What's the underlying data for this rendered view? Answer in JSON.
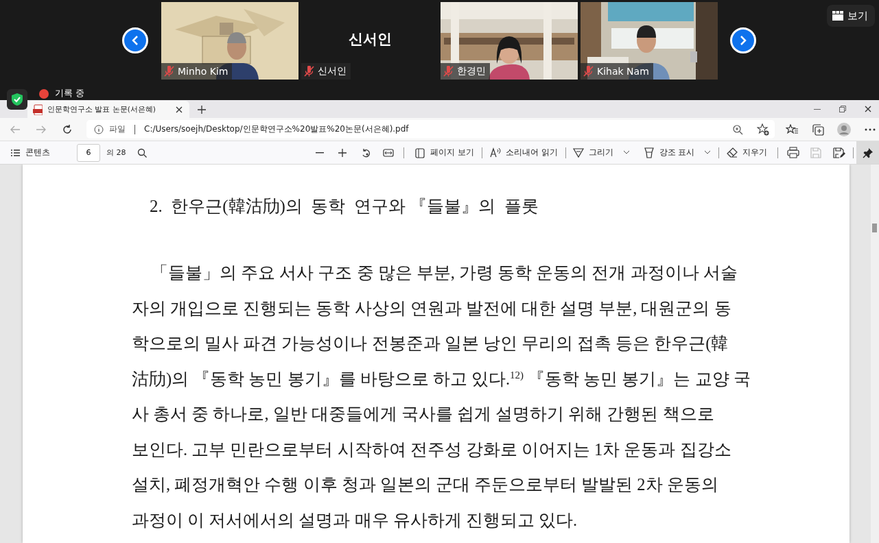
{
  "meeting": {
    "participants": [
      {
        "kind": "video",
        "name": "Minho Kim",
        "muted": true
      },
      {
        "kind": "name",
        "name": "신서인",
        "label": "신서인",
        "muted": true
      },
      {
        "kind": "video",
        "name": "한경민",
        "muted": true
      },
      {
        "kind": "video",
        "name": "Kihak Nam",
        "muted": true
      }
    ],
    "view_button": "보기",
    "recording": "기록 중"
  },
  "browser": {
    "tabs": [
      {
        "title": "인문학연구소 발표 논문(서은혜)",
        "selected": true
      }
    ],
    "address": {
      "scheme": "파일",
      "url": "C:/Users/soejh/Desktop/인문학연구소%20발표%20논문(서은혜).pdf"
    },
    "pdf_toolbar": {
      "contents": "콘텐츠",
      "page": "6",
      "page_count": "의 28",
      "tools": [
        {
          "kind": "pageview",
          "label": "페이지 보기",
          "dropdown": false
        },
        {
          "kind": "read",
          "label": "소리내어 읽기",
          "dropdown": false
        },
        {
          "kind": "draw",
          "label": "그리기",
          "dropdown": true
        },
        {
          "kind": "highlight",
          "label": "강조 표시",
          "dropdown": true
        },
        {
          "kind": "erase",
          "label": "지우기",
          "dropdown": false
        }
      ],
      "save_disabled": true,
      "pinned": true
    }
  },
  "document": {
    "heading": "2.  한우근(韓沽劤)의  동학  연구와 『들불』의  플롯",
    "lines": [
      "「들불」의 주요 서사 구조 중 많은 부분, 가령 동학 운동의 전개 과정이나 서술",
      "자의 개입으로 진행되는 동학 사상의 연원과 발전에 대한 설명 부분, 대원군의 동",
      "학으로의 밀사 파견 가능성이나 전봉준과 일본 낭인 무리의 접촉 등은 한우근(韓",
      "沽劤)의 『동학 농민 봉기』를 바탕으로 하고 있다.$^{12)}$ 『동학 농민 봉기』는 교양 국",
      "사 총서 중 하나로, 일반 대중들에게 국사를 쉽게 설명하기 위해 간행된 책으로",
      "보인다. 고부 민란으로부터 시작하여 전주성 강화로 이어지는 1차 운동과 집강소",
      "설치, 폐정개혁안 수행 이후 청과 일본의 군대 주둔으로부터 발발된 2차 운동의",
      "과정이 이 저서에서의 설명과 매우 유사하게 진행되고 있다."
    ]
  }
}
